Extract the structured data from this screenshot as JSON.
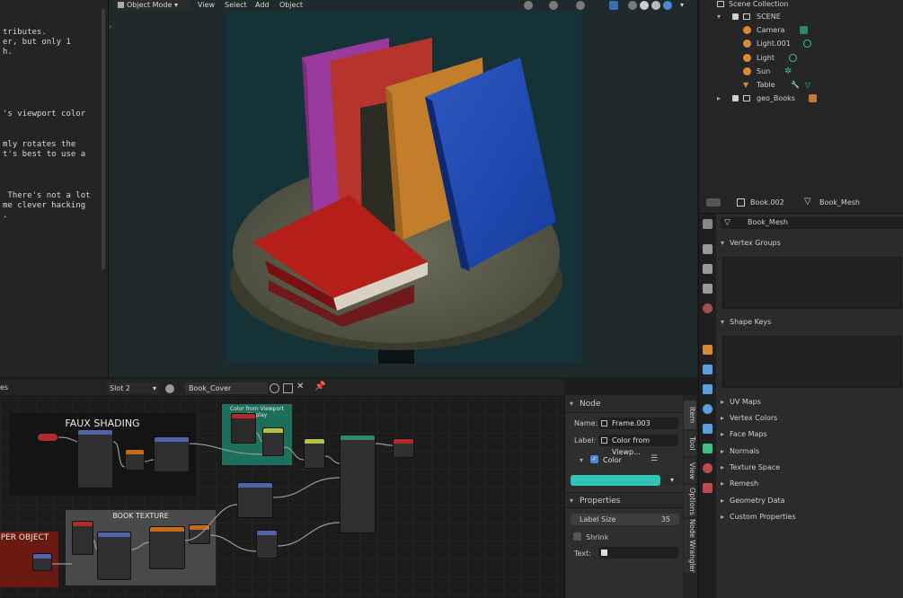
{
  "text_editor": {
    "lines": [
      "tributes.",
      "er, but only 1",
      "h.",
      "'s viewport color",
      "mly rotates the",
      "t's best to use a",
      " There's not a lot",
      "me clever hacking",
      "."
    ]
  },
  "viewport_header": {
    "mode": "Object Mode",
    "menus": [
      "View",
      "Select",
      "Add",
      "Object"
    ]
  },
  "outliner": {
    "title": "Scene Collection",
    "scene": "SCENE",
    "objects": [
      "Camera",
      "Light.001",
      "Light",
      "Sun",
      "Table"
    ],
    "collection": "geo_Books"
  },
  "properties": {
    "object_name": "Book.002",
    "mesh_name": "Book_Mesh",
    "datablock": "Book_Mesh",
    "sections": [
      "Vertex Groups",
      "Shape Keys",
      "UV Maps",
      "Vertex Colors",
      "Face Maps",
      "Normals",
      "Texture Space",
      "Remesh",
      "Geometry Data",
      "Custom Properties"
    ]
  },
  "node_editor": {
    "header_left": "es",
    "slot": "Slot 2",
    "material": "Book_Cover",
    "frames": {
      "faux_shading": "FAUX SHADING",
      "color_from_viewport": "Color from Viewport Display",
      "book_texture": "BOOK TEXTURE",
      "per_object": "PER OBJECT"
    }
  },
  "node_panel": {
    "section": "Node",
    "name_label": "Name:",
    "name_value": "Frame.003",
    "label_label": "Label:",
    "label_value": "Color from Viewp...",
    "color_label": "Color",
    "color_hex": "#2fc4b8",
    "properties_section": "Properties",
    "label_size_label": "Label Size",
    "label_size_value": "35",
    "shrink_label": "Shrink",
    "text_label": "Text:"
  },
  "sidebar_tabs": [
    "Item",
    "Tool",
    "View",
    "Options",
    "Node Wrangler"
  ]
}
